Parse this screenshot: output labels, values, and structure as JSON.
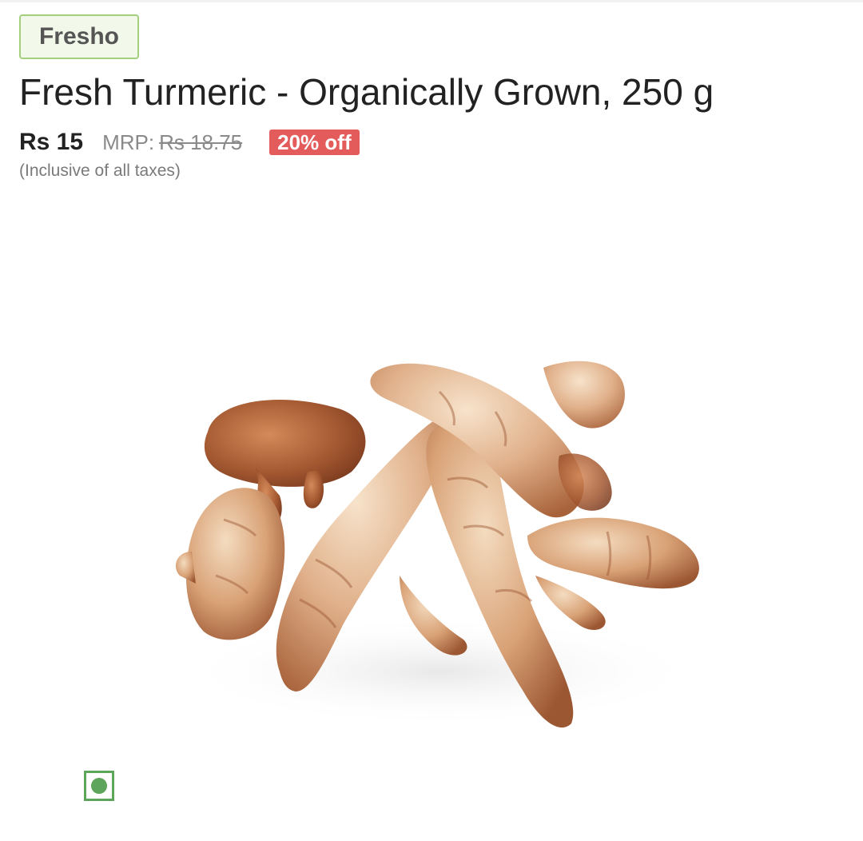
{
  "product": {
    "brand": "Fresho",
    "title": "Fresh Turmeric - Organically Grown, 250 g",
    "price": "Rs 15",
    "mrp_label": "MRP:",
    "mrp_value": "Rs 18.75",
    "discount": "20% off",
    "tax_note": "(Inclusive of all taxes)"
  },
  "image": {
    "subject": "turmeric-roots"
  },
  "indicator": {
    "type": "veg-indicator",
    "color": "#5da55a"
  },
  "colors": {
    "brand_chip_bg": "#f2f9ea",
    "brand_chip_border": "#a4cf7d",
    "discount_badge": "#e35b5b"
  }
}
